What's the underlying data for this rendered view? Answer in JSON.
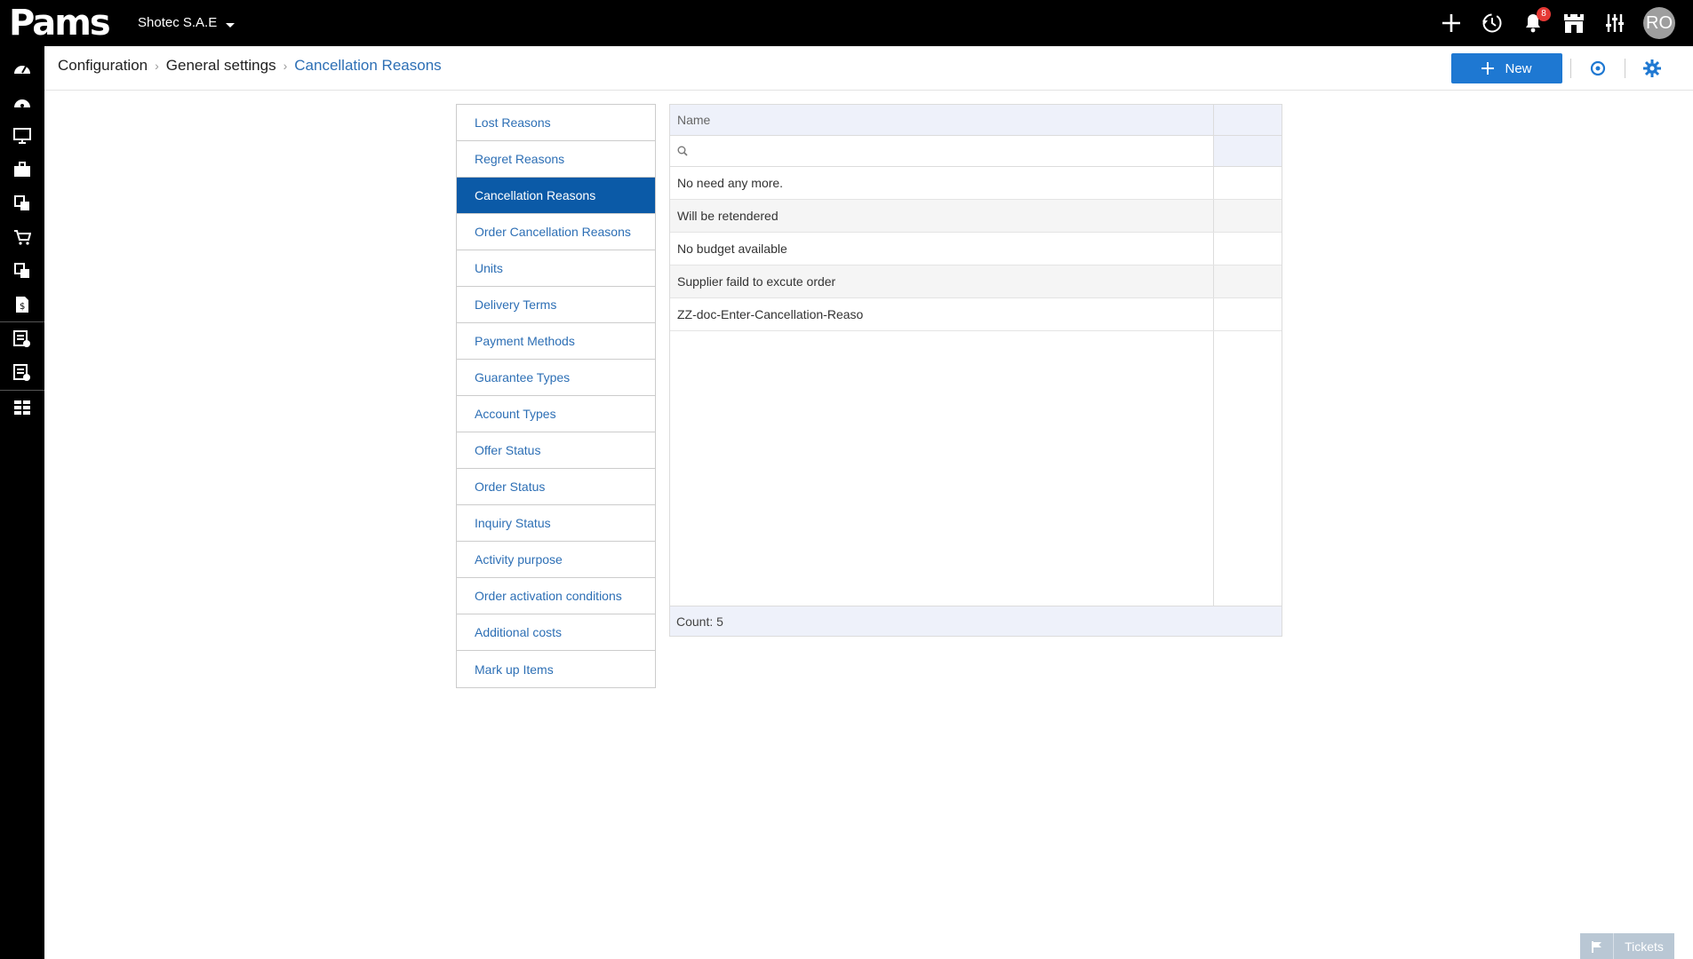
{
  "app": {
    "logo_text": "Pams",
    "company": "Shotec S.A.E",
    "notifications_count": "8",
    "user_initials": "RO"
  },
  "breadcrumb": {
    "items": [
      "Configuration",
      "General settings",
      "Cancellation Reasons"
    ]
  },
  "toolbar": {
    "new_label": "New"
  },
  "settings_menu": {
    "items": [
      "Lost Reasons",
      "Regret Reasons",
      "Cancellation Reasons",
      "Order Cancellation Reasons",
      "Units",
      "Delivery Terms",
      "Payment Methods",
      "Guarantee Types",
      "Account Types",
      "Offer Status",
      "Order Status",
      "Inquiry Status",
      "Activity purpose",
      "Order activation conditions",
      "Additional costs",
      "Mark up Items"
    ],
    "active": "Cancellation Reasons"
  },
  "grid": {
    "column_name": "Name",
    "filter_placeholder": "",
    "rows": [
      "No need any more.",
      "Will be retendered",
      "No budget available",
      "Supplier faild to excute order",
      "ZZ-doc-Enter-Cancellation-Reaso"
    ],
    "count_label": "Count: 5"
  },
  "tickets": {
    "label": "Tickets"
  },
  "colors": {
    "accent": "#1e78d2",
    "active_menu": "#0b5aa7",
    "link": "#2d6fb5",
    "grid_header": "#eef1fa"
  }
}
